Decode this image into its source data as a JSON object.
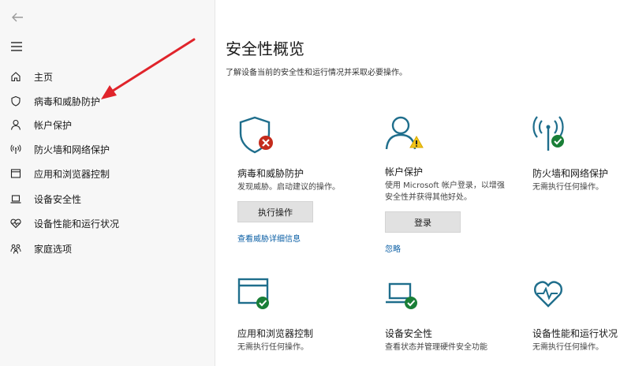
{
  "colors": {
    "accent": "#1f6e8c",
    "ok": "#1a7f37",
    "error": "#c42b1c",
    "warning": "#f0c419",
    "arrow": "#e0242b",
    "link": "#0b5fa5"
  },
  "sidebar": {
    "items": [
      {
        "label": "主页",
        "icon": "home-icon"
      },
      {
        "label": "病毒和威胁防护",
        "icon": "shield-icon"
      },
      {
        "label": "帐户保护",
        "icon": "person-icon"
      },
      {
        "label": "防火墙和网络保护",
        "icon": "wifi-antenna-icon"
      },
      {
        "label": "应用和浏览器控制",
        "icon": "app-window-icon"
      },
      {
        "label": "设备安全性",
        "icon": "laptop-icon"
      },
      {
        "label": "设备性能和运行状况",
        "icon": "heart-pulse-icon"
      },
      {
        "label": "家庭选项",
        "icon": "family-icon"
      }
    ]
  },
  "main": {
    "title": "安全性概览",
    "subtitle": "了解设备当前的安全性和运行情况并采取必要操作。",
    "cards": [
      {
        "title": "病毒和威胁防护",
        "desc": [
          "发现威胁。启动建议的操作。"
        ],
        "button": "执行操作",
        "link": "查看威胁详细信息",
        "status": "error"
      },
      {
        "title": "帐户保护",
        "desc": [
          "使用 Microsoft 帐户登录，以增强",
          "安全性并获得其他好处。"
        ],
        "button": "登录",
        "link": "忽略",
        "status": "warning"
      },
      {
        "title": "防火墙和网络保护",
        "desc": [
          "无需执行任何操作。"
        ],
        "status": "ok"
      },
      {
        "title": "应用和浏览器控制",
        "desc": [
          "无需执行任何操作。"
        ],
        "status": "ok"
      },
      {
        "title": "设备安全性",
        "desc": [
          "查看状态并管理硬件安全功能"
        ],
        "status": "ok"
      },
      {
        "title": "设备性能和运行状况",
        "desc": [
          "无需执行任何操作。"
        ],
        "status": "ok"
      }
    ]
  }
}
